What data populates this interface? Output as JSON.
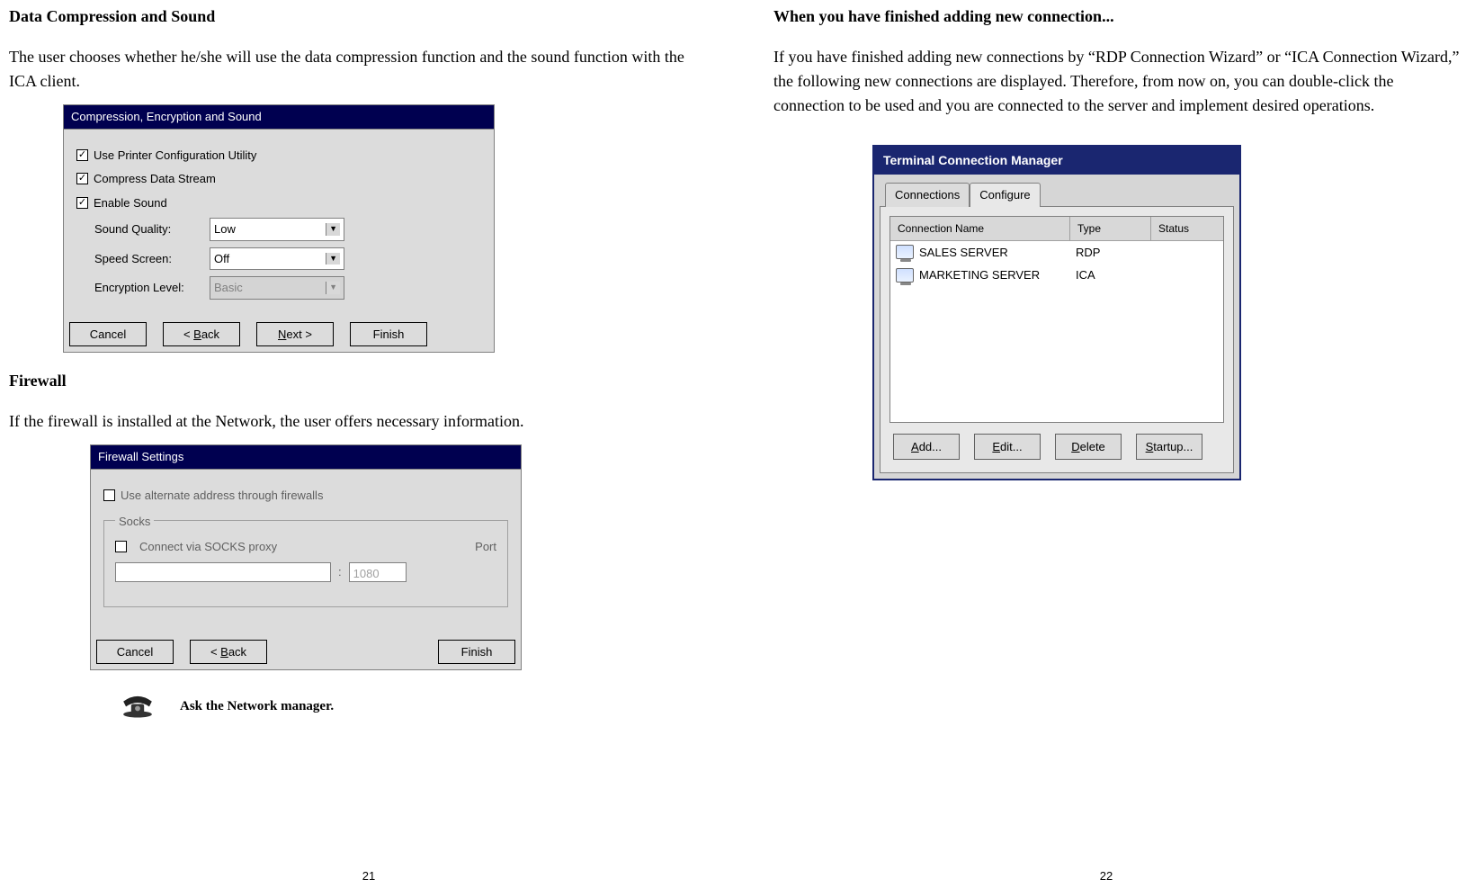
{
  "left": {
    "h1": "Data Compression and Sound",
    "p1": "The user chooses whether he/she will use the data compression function and the sound function with the ICA client.",
    "dialog1": {
      "title": "Compression, Encryption and Sound",
      "chk1": "Use Printer Configuration Utility",
      "chk2": "Compress Data Stream",
      "chk3": "Enable Sound",
      "sq_lbl": "Sound Quality:",
      "sq_val": "Low",
      "ss_lbl": "Speed Screen:",
      "ss_val": "Off",
      "el_lbl": "Encryption Level:",
      "el_val": "Basic",
      "btn_cancel": "Cancel",
      "btn_back_pre": "< ",
      "btn_back_u": "B",
      "btn_back_post": "ack",
      "btn_next_u": "N",
      "btn_next_post": "ext >",
      "btn_finish": "Finish"
    },
    "h2": "Firewall",
    "p2": "If the firewall is installed at the Network, the user offers necessary information.",
    "dialog2": {
      "title": "Firewall Settings",
      "chk_alt": "Use alternate address through firewalls",
      "group": "Socks",
      "chk_socks": "Connect via SOCKS proxy",
      "port_lbl": "Port",
      "colon": ":",
      "port_val": "1080",
      "btn_cancel": "Cancel",
      "btn_back_pre": "< ",
      "btn_back_u": "B",
      "btn_back_post": "ack",
      "btn_finish": "Finish"
    },
    "note": "Ask the Network manager.",
    "page": "21"
  },
  "right": {
    "h1": "When you have finished adding new connection...",
    "p1": "If you have finished adding new connections by “RDP Connection Wizard” or “ICA Connection Wizard,” the following new connections are displayed. Therefore, from now on, you can double-click the connection to be used and you are connected to the server and implement desired operations.",
    "tcm": {
      "title": "Terminal Connection Manager",
      "tab1": "Connections",
      "tab2": "Configure",
      "col_name": "Connection Name",
      "col_type": "Type",
      "col_status": "Status",
      "rows": [
        {
          "name": "SALES SERVER",
          "type": "RDP"
        },
        {
          "name": "MARKETING SERVER",
          "type": "ICA"
        }
      ],
      "btn_add_u": "A",
      "btn_add_post": "dd...",
      "btn_edit_u": "E",
      "btn_edit_post": "dit...",
      "btn_delete_u": "D",
      "btn_delete_post": "elete",
      "btn_startup_u": "S",
      "btn_startup_post": "tartup..."
    },
    "page": "22"
  }
}
